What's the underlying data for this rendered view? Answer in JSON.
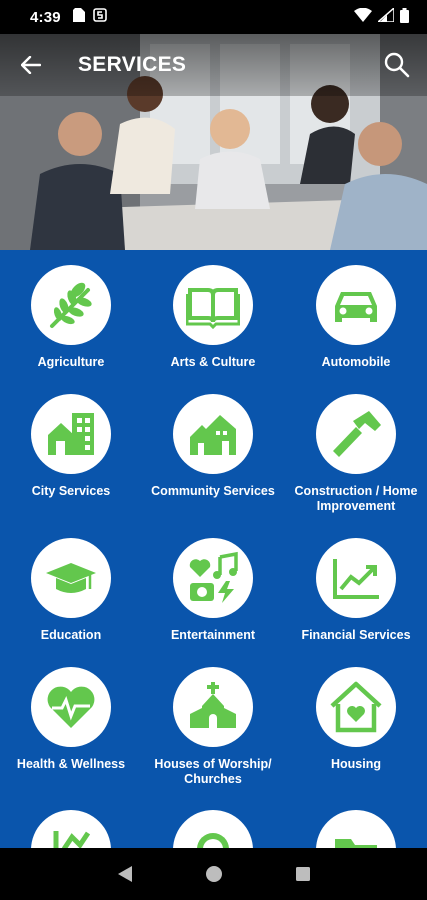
{
  "status_bar": {
    "time": "4:39",
    "icons": [
      "sd-card-icon",
      "s-app-icon",
      "wifi-icon",
      "signal-icon",
      "battery-icon"
    ]
  },
  "toolbar": {
    "title": "SERVICES",
    "back_icon": "arrow-back-icon",
    "search_icon": "search-icon"
  },
  "hero": {
    "description_icon": "business-meeting-photo"
  },
  "colors": {
    "background_blue": "#0a55ac",
    "icon_green": "#63c74d",
    "circle_white": "#ffffff"
  },
  "services": [
    {
      "label": "Agriculture",
      "icon": "wheat-icon"
    },
    {
      "label": "Arts & Culture",
      "icon": "book-icon"
    },
    {
      "label": "Automobile",
      "icon": "car-icon"
    },
    {
      "label": "City Services",
      "icon": "city-buildings-icon"
    },
    {
      "label": "Community Services",
      "icon": "houses-icon"
    },
    {
      "label": "Construction / Home Improvement",
      "icon": "hammer-icon"
    },
    {
      "label": "Education",
      "icon": "graduation-cap-icon"
    },
    {
      "label": "Entertainment",
      "icon": "entertainment-icon"
    },
    {
      "label": "Financial Services",
      "icon": "chart-line-icon"
    },
    {
      "label": "Health & Wellness",
      "icon": "heart-pulse-icon"
    },
    {
      "label": "Houses of Worship/ Churches",
      "icon": "church-icon"
    },
    {
      "label": "Housing",
      "icon": "house-heart-icon"
    },
    {
      "label": "",
      "icon": "partial-icon"
    },
    {
      "label": "",
      "icon": "partial-icon"
    },
    {
      "label": "",
      "icon": "partial-icon"
    }
  ],
  "nav_bar": {
    "back": "nav-back-icon",
    "home": "nav-home-icon",
    "recents": "nav-recents-icon"
  }
}
